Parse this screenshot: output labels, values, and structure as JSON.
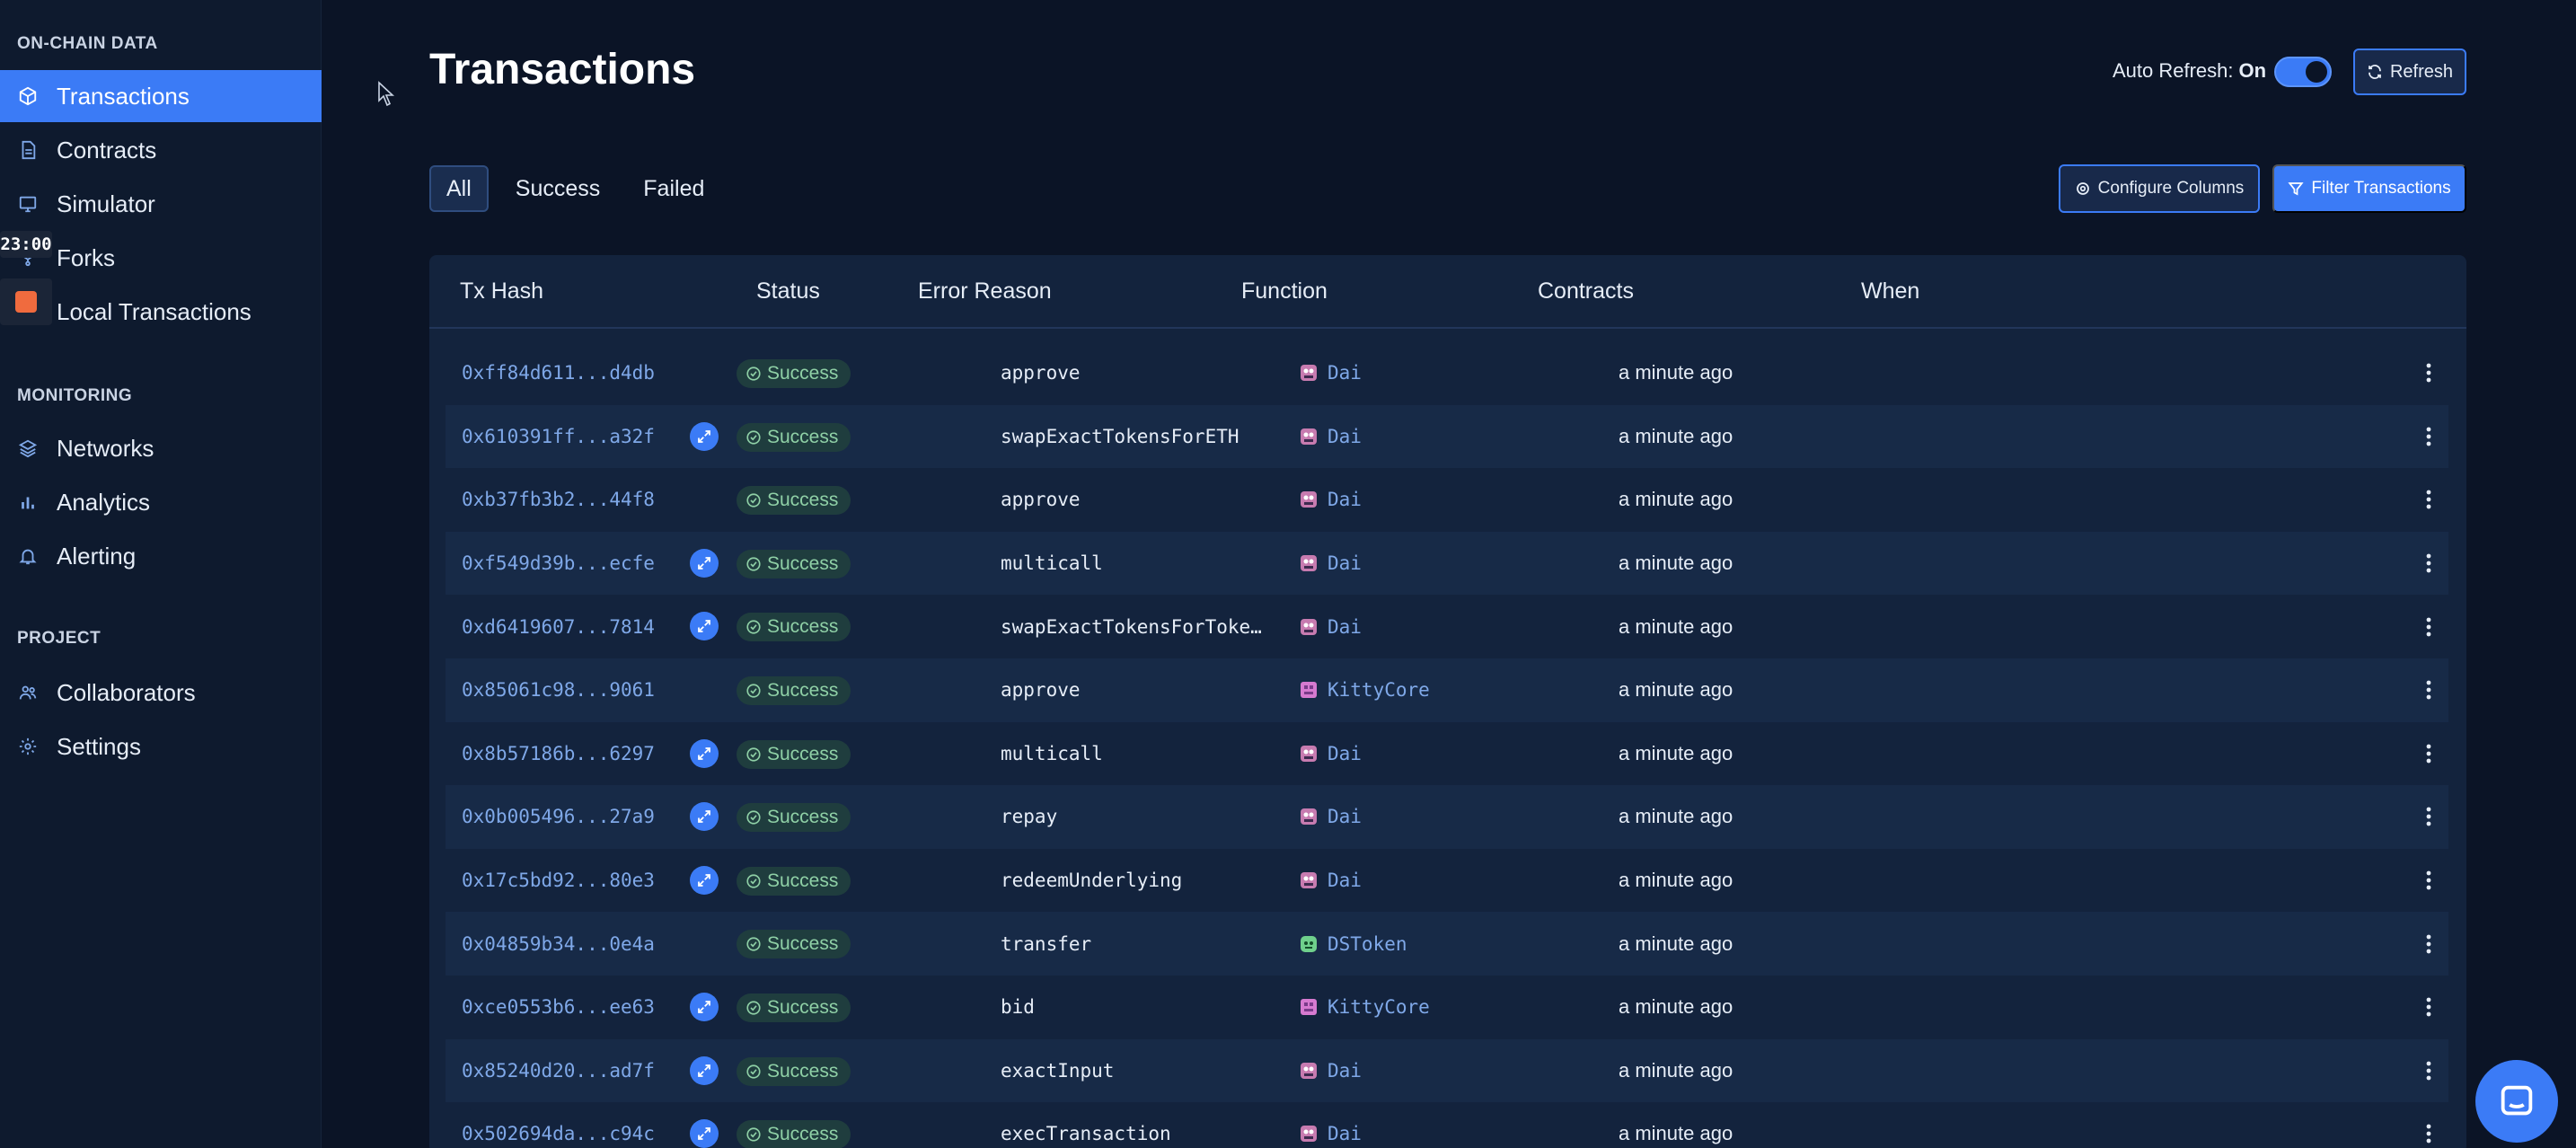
{
  "sidebar": {
    "sections": [
      {
        "title": "ON-CHAIN DATA"
      },
      {
        "title": "MONITORING"
      },
      {
        "title": "PROJECT"
      }
    ],
    "items": [
      {
        "label": "Transactions",
        "icon": "cube-icon",
        "active": true
      },
      {
        "label": "Contracts",
        "icon": "document-icon"
      },
      {
        "label": "Simulator",
        "icon": "monitor-icon"
      },
      {
        "label": "Forks",
        "icon": "fork-icon"
      },
      {
        "label": "Local Transactions",
        "icon": "terminal-icon"
      },
      {
        "label": "Networks",
        "icon": "layers-icon"
      },
      {
        "label": "Analytics",
        "icon": "bar-chart-icon"
      },
      {
        "label": "Alerting",
        "icon": "bell-icon"
      },
      {
        "label": "Collaborators",
        "icon": "users-icon"
      },
      {
        "label": "Settings",
        "icon": "gear-icon"
      }
    ],
    "overlay_time": "23:00"
  },
  "header": {
    "title": "Transactions",
    "auto_refresh_label": "Auto Refresh:",
    "auto_refresh_state": "On",
    "refresh_label": "Refresh"
  },
  "filters": {
    "tabs": [
      {
        "label": "All",
        "active": true
      },
      {
        "label": "Success"
      },
      {
        "label": "Failed"
      }
    ],
    "configure_columns_label": "Configure Columns",
    "filter_transactions_label": "Filter Transactions"
  },
  "table": {
    "columns": [
      "Tx Hash",
      "Status",
      "Error Reason",
      "Function",
      "Contracts",
      "When"
    ],
    "rows": [
      {
        "hash": "0xff84d611...d4db",
        "link": false,
        "status": "Success",
        "function": "approve",
        "contract": "Dai",
        "contract_icon": "dai",
        "when": "a minute ago"
      },
      {
        "hash": "0x610391ff...a32f",
        "link": true,
        "status": "Success",
        "function": "swapExactTokensForETH",
        "contract": "Dai",
        "contract_icon": "dai",
        "when": "a minute ago"
      },
      {
        "hash": "0xb37fb3b2...44f8",
        "link": false,
        "status": "Success",
        "function": "approve",
        "contract": "Dai",
        "contract_icon": "dai",
        "when": "a minute ago"
      },
      {
        "hash": "0xf549d39b...ecfe",
        "link": true,
        "status": "Success",
        "function": "multicall",
        "contract": "Dai",
        "contract_icon": "dai",
        "when": "a minute ago"
      },
      {
        "hash": "0xd6419607...7814",
        "link": true,
        "status": "Success",
        "function": "swapExactTokensForToke…",
        "contract": "Dai",
        "contract_icon": "dai",
        "when": "a minute ago"
      },
      {
        "hash": "0x85061c98...9061",
        "link": false,
        "status": "Success",
        "function": "approve",
        "contract": "KittyCore",
        "contract_icon": "kitty",
        "when": "a minute ago"
      },
      {
        "hash": "0x8b57186b...6297",
        "link": true,
        "status": "Success",
        "function": "multicall",
        "contract": "Dai",
        "contract_icon": "dai",
        "when": "a minute ago"
      },
      {
        "hash": "0x0b005496...27a9",
        "link": true,
        "status": "Success",
        "function": "repay",
        "contract": "Dai",
        "contract_icon": "dai",
        "when": "a minute ago"
      },
      {
        "hash": "0x17c5bd92...80e3",
        "link": true,
        "status": "Success",
        "function": "redeemUnderlying",
        "contract": "Dai",
        "contract_icon": "dai",
        "when": "a minute ago"
      },
      {
        "hash": "0x04859b34...0e4a",
        "link": false,
        "status": "Success",
        "function": "transfer",
        "contract": "DSToken",
        "contract_icon": "dstoken",
        "when": "a minute ago"
      },
      {
        "hash": "0xce0553b6...ee63",
        "link": true,
        "status": "Success",
        "function": "bid",
        "contract": "KittyCore",
        "contract_icon": "kitty",
        "when": "a minute ago"
      },
      {
        "hash": "0x85240d20...ad7f",
        "link": true,
        "status": "Success",
        "function": "exactInput",
        "contract": "Dai",
        "contract_icon": "dai",
        "when": "a minute ago"
      },
      {
        "hash": "0x502694da...c94c",
        "link": true,
        "status": "Success",
        "function": "execTransaction",
        "contract": "Dai",
        "contract_icon": "dai",
        "when": "a minute ago"
      }
    ]
  },
  "colors": {
    "accent": "#3b7bf6",
    "background": "#0b1426",
    "sidebar": "#0e1a2e",
    "success": "#8fd0a6",
    "link": "#7fa8e8"
  },
  "chat": {
    "icon": "chat-icon"
  }
}
